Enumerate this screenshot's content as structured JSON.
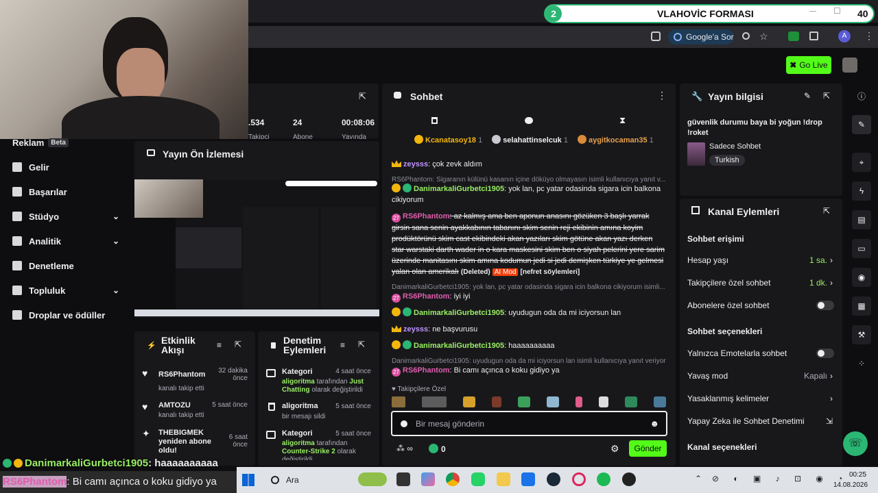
{
  "browser": {
    "title": "VLAHOVİC FORMASI",
    "badge_number": "2",
    "right_count": "40",
    "google_ask": "Google'a Sor",
    "avatar_letter": "A"
  },
  "app": {
    "go_live": "Go Live"
  },
  "stats": {
    "followers": ".534",
    "subs": "24",
    "uptime": "00:08:06",
    "followers_label": "Takipçi",
    "subs_label": "Abone",
    "uptime_label": "Yayında"
  },
  "sidebar": {
    "items": [
      {
        "label": "Reklam",
        "badge": "Beta"
      },
      {
        "label": "Gelir"
      },
      {
        "label": "Başarılar"
      },
      {
        "label": "Stüdyo"
      },
      {
        "label": "Analitik"
      },
      {
        "label": "Denetleme"
      },
      {
        "label": "Topluluk"
      },
      {
        "label": "Droplar ve ödüller"
      }
    ]
  },
  "preview": {
    "title": "Yayın Ön İzlemesi"
  },
  "activity": {
    "title": "Etkinlik Akışı",
    "items": [
      {
        "name": "RS6Phantom",
        "sub": "kanalı takip etti",
        "time": "32 dakika önce"
      },
      {
        "name": "AMTOZU",
        "sub": "kanalı takip etti",
        "time": "5 saat önce"
      },
      {
        "name": "THEBIGMEK yeniden abone oldu!",
        "sub": "",
        "time": "6 saat önce"
      }
    ]
  },
  "mod_actions": {
    "title": "Denetim Eylemleri",
    "items": [
      {
        "name": "Kategori",
        "by": "aligoritma",
        "mid": "tarafından",
        "target": "Just Chatting",
        "rest": "olarak değiştirildi",
        "time": "4 saat önce"
      },
      {
        "name": "aligoritma",
        "sub": "bir mesajı sildi",
        "time": "5 saat önce"
      },
      {
        "name": "Kategori",
        "by": "aligoritma",
        "mid": "tarafından",
        "target": "Counter-Strike 2",
        "rest": "olarak değiştirildi",
        "time": "5 saat önce"
      }
    ]
  },
  "chat": {
    "title": "Sohbet",
    "leaders": [
      {
        "rank": "1",
        "name": "Kcanatasoy18",
        "n": "1"
      },
      {
        "rank": "2",
        "name": "selahattinselcuk",
        "n": "1"
      },
      {
        "rank": "3",
        "name": "aygitkocaman35",
        "n": "1"
      }
    ],
    "msg1_user": "zeysss",
    "msg1_text": ": çok zevk aldım",
    "reply1": "RS6Phantom: Sigaranın külünü kasanın içine döküyo olmayasın isimli kullanıcıya yanıt v...",
    "msg2_user": "DanimarkaliGurbetci1905",
    "msg2_text": ": yok lan, pc yatar odasinda sigara icin balkona cikiyorum",
    "msg3_user": "RS6Phantom",
    "msg3_text": ": az kalmış ama ben aponun anasını gözüken 3 başlı yarrak girsin sana senin ayakkabının tabanını skim senin reji ekibinin amına koyim prodüktörünü skim cast ekibindeki akan yazıları skim götüne akan yazı derken star warstaki darth wader in o kara maskesini skim ben o siyah pelerini yere sarim üzerinde manitasını skim amına kodumun jedi si jedi demişken türkiye ye gelmesi yalan olan amerikalı",
    "deleted": "(Deleted)",
    "aimod": "AI Mod",
    "hate": "[nefret söylemleri]",
    "reply2": "DanimarkaliGurbetci1905: yok lan, pc yatar odasinda sigara icin balkona cikiyorum isimli...",
    "msg4_user": "RS6Phantom",
    "msg4_text": ": iyi iyi",
    "msg5_user": "DanimarkaliGurbetci1905",
    "msg5_text": ": uyudugun oda da mi iciyorsun lan",
    "msg6_user": "zeysss",
    "msg6_text": ": ne başvurusu",
    "msg7_user": "DanimarkaliGurbetci1905",
    "msg7_text": ": haaaaaaaaaa",
    "reply3": "DanimarkaliGurbetci1905: uyudugun oda da mi iciyorsun lan isimli kullanıcıya yanıt veriyor",
    "msg8_user": "RS6Phantom",
    "msg8_text": ": Bi camı açınca o koku gidiyo ya",
    "emote_label": "Takipçilere Özel",
    "placeholder": "Bir mesaj gönderin",
    "points": "0",
    "send": "Gönder"
  },
  "stream_info": {
    "title": "Yayın bilgisi",
    "stream_title": "güvenlik durumu baya bi yoğun !drop !roket",
    "category": "Sadece Sohbet",
    "tag": "Turkish"
  },
  "channel_actions": {
    "title": "Kanal Eylemleri",
    "chat_access": "Sohbet erişimi",
    "account_age": "Hesap yaşı",
    "account_age_val": "1 sa.",
    "followers_only": "Takipçilere özel sohbet",
    "followers_only_val": "1 dk.",
    "subs_only": "Abonelere özel sohbet",
    "chat_options": "Sohbet seçenekleri",
    "emote_only": "Yalnızca Emotelarla sohbet",
    "slow_mode": "Yavaş mod",
    "slow_mode_val": "Kapalı",
    "banned_words": "Yasaklanmış kelimeler",
    "ai_mod": "Yapay Zeka ile Sohbet Denetimi",
    "channel_options": "Kanal seçenekleri"
  },
  "overlay": {
    "line1_user": "DanimarkaliGurbetci1905",
    "line1_text": ": haaaaaaaaaa",
    "line2_user": "RS6Phantom",
    "line2_text": ": Bi camı açınca o koku gidiyo ya"
  },
  "taskbar": {
    "search": "Ara",
    "time": "00:25",
    "date": "14.08.2026"
  }
}
